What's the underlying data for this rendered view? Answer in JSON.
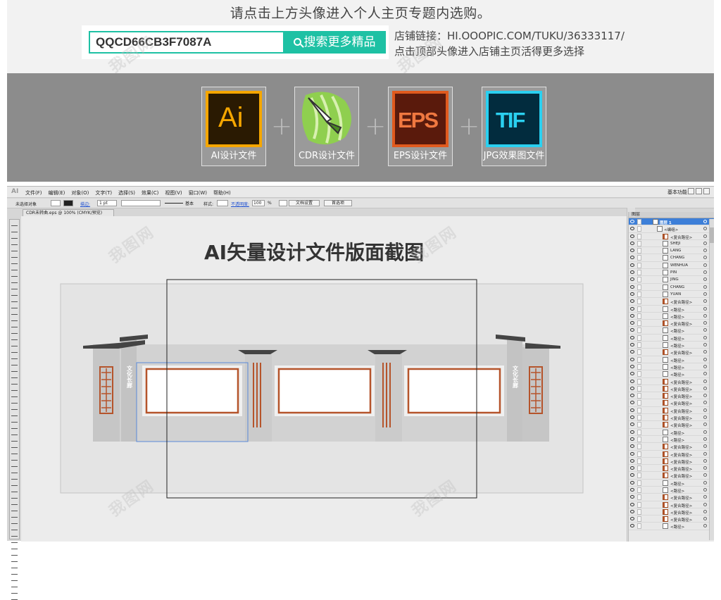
{
  "promo": {
    "headline": "请点击上方头像进入个人主页专题内选购。",
    "search_value": "QQCD66CB3F7087A",
    "search_button": "搜索更多精品",
    "shop_link_line": "店铺链接：HI.OOOPIC.COM/TUKU/36333117/",
    "shop_hint_line": "点击顶部头像进入店铺主页活得更多选择"
  },
  "formats": [
    {
      "logo": "Ai",
      "caption": "AI设计文件",
      "icon": "illustrator-icon"
    },
    {
      "logo": "",
      "caption": "CDR设计文件",
      "icon": "coreldraw-icon"
    },
    {
      "logo": "EPS",
      "caption": "EPS设计文件",
      "icon": "eps-icon"
    },
    {
      "logo": "TIF",
      "caption": "JPG效果图文件",
      "icon": "tif-icon"
    }
  ],
  "plus_sign": "+",
  "colors": {
    "accent": "#1ec1a4",
    "ai": "#f5a600",
    "eps": "#e05a1e",
    "tif": "#2ad0f0",
    "cdr": "#7fc241",
    "wall_frame": "#b5542b"
  },
  "illustrator": {
    "app_logo": "AI",
    "menus": [
      "文件(F)",
      "编辑(E)",
      "对象(O)",
      "文字(T)",
      "选择(S)",
      "效果(C)",
      "视图(V)",
      "窗口(W)",
      "帮助(H)"
    ],
    "workspace": "基本功能",
    "control_bar": {
      "no_selection": "未选择对象",
      "stroke_label": "描边:",
      "stroke_value": "1 pt",
      "brush_label": "基本",
      "style_label": "样式:",
      "opacity_label": "不透明度:",
      "opacity_value": "100",
      "opacity_unit": "%",
      "doc_setup": "文档设置",
      "preferences": "首选项"
    },
    "doc_tab": "CDR未转曲.eps @ 100% (CMYK/预览)",
    "artboard_title": "AI矢量设计文件版面截图",
    "wall_text_left": "文化长廊",
    "wall_text_right": "文化长廊",
    "layers_panel": {
      "title": "图层",
      "top_layer": "图层 1",
      "group": "<编组>",
      "items": [
        "<复合路径>",
        "SHEJI",
        "LANG",
        "CHANG",
        "WENHUA",
        "PIN",
        "JING",
        "CHANG",
        "YUAN",
        "<复合路径>",
        "<路径>",
        "<路径>",
        "<复合路径>",
        "<路径>",
        "<路径>",
        "<路径>",
        "<复合路径>",
        "<路径>",
        "<路径>",
        "<路径>",
        "<复合路径>",
        "<复合路径>",
        "<复合路径>",
        "<复合路径>",
        "<复合路径>",
        "<复合路径>",
        "<复合路径>",
        "<路径>",
        "<路径>",
        "<复合路径>",
        "<复合路径>",
        "<复合路径>",
        "<复合路径>",
        "<复合路径>",
        "<路径>",
        "<路径>",
        "<复合路径>",
        "<复合路径>",
        "<复合路径>",
        "<复合路径>",
        "<路径>"
      ]
    }
  }
}
